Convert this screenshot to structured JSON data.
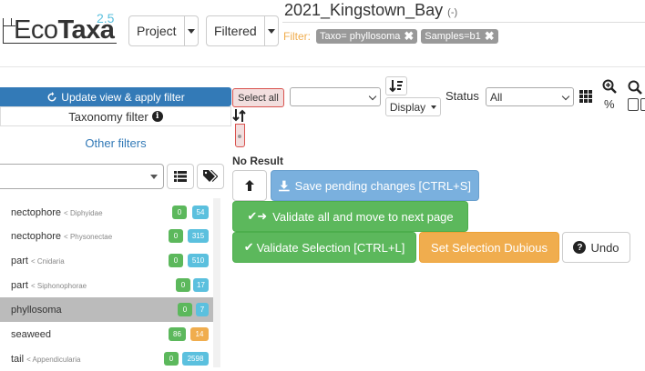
{
  "app": {
    "logo_main": "Eco",
    "logo_bold": "Taxa",
    "version": "2.5"
  },
  "header": {
    "project_label": "Project",
    "filtered_label": "Filtered",
    "project_name": "2021_Kingstown_Bay",
    "project_suffix": "(-)",
    "filter_label": "Filter:",
    "filter_tags": [
      {
        "label": "Taxo= phyllosoma"
      },
      {
        "label": "Samples=b1"
      }
    ]
  },
  "left_panel": {
    "update_button": "Update view & apply filter",
    "taxonomy_filter": "Taxonomy filter",
    "other_filters": "Other filters",
    "taxa": [
      {
        "name": "nectophore",
        "parent": "< Diphyidae",
        "validated": "0",
        "predicted": "54"
      },
      {
        "name": "nectophore",
        "parent": "< Physonectae",
        "validated": "0",
        "predicted": "315"
      },
      {
        "name": "part",
        "parent": "< Cnidaria",
        "validated": "0",
        "predicted": "510"
      },
      {
        "name": "part",
        "parent": "< Siphonophorae",
        "validated": "0",
        "predicted": "17"
      },
      {
        "name": "phyllosoma",
        "parent": "",
        "validated": "0",
        "predicted": "7"
      },
      {
        "name": "seaweed",
        "parent": "",
        "validated": "86",
        "predicted": "14"
      },
      {
        "name": "tail",
        "parent": "< Appendicularia",
        "validated": "0",
        "predicted": "2598"
      }
    ]
  },
  "toolbar": {
    "select_all": "Select all",
    "display_label": "Display",
    "status_label": "Status",
    "status_value": "All",
    "zoom_unit": "%"
  },
  "actions": {
    "no_result": "No Result",
    "save": "Save pending changes [CTRL+S]",
    "validate_next": "Validate all and move to next page",
    "validate_selection": "Validate Selection [CTRL+L]",
    "dubious": "Set Selection Dubious",
    "undo": "Undo"
  },
  "colors": {
    "primary": "#337ab7",
    "success": "#5cb85c",
    "info": "#5bc0de",
    "warning": "#f0ad4e",
    "danger_light": "#f2dede"
  }
}
